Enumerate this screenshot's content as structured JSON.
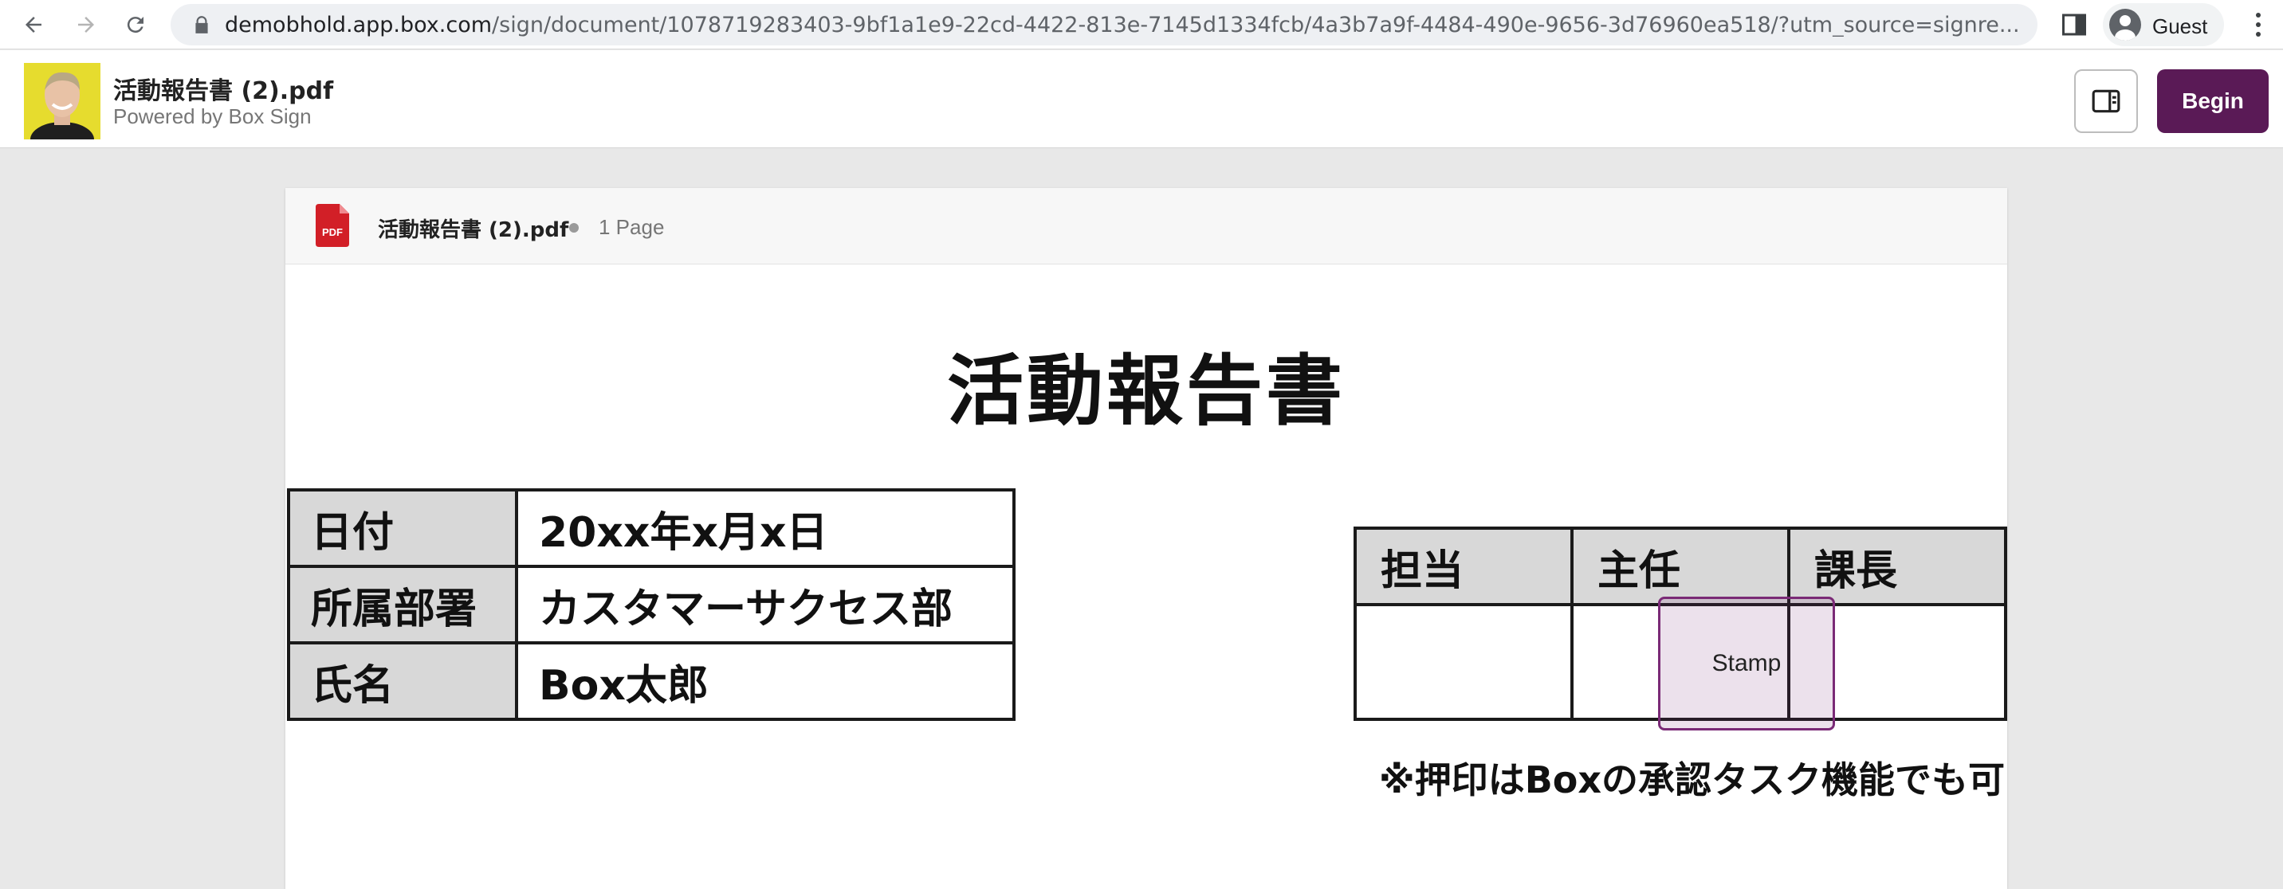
{
  "browser": {
    "url_host": "demobhold.app.box.com",
    "url_path": "/sign/document/1078719283403-9bf1a1e9-22cd-4422-813e-7145d1334fcb/4a3b7a9f-4484-490e-9656-3d76960ea518/?utm_source=signre...",
    "profile_label": "Guest",
    "icons": [
      "back-icon",
      "forward-icon",
      "reload-icon",
      "lock-icon",
      "side-panel-icon",
      "profile-icon",
      "more-icon"
    ]
  },
  "header": {
    "title": "活動報告書 (2).pdf",
    "subtitle": "Powered by Box Sign",
    "begin_label": "Begin",
    "accent_color": "#5a1a56"
  },
  "document": {
    "file_name": "活動報告書 (2).pdf",
    "page_count": "1 Page",
    "icon_label": "PDF",
    "title": "活動報告書",
    "info_rows": [
      {
        "label": "日付",
        "value": "20xx年x月x日"
      },
      {
        "label": "所属部署",
        "value": "カスタマーサクセス部"
      },
      {
        "label": "氏名",
        "value": "Box太郎"
      }
    ],
    "approval_headers": [
      "担当",
      "主任",
      "課長"
    ],
    "stamp_label": "Stamp",
    "note": "※押印はBoxの承認タスク機能でも可"
  }
}
